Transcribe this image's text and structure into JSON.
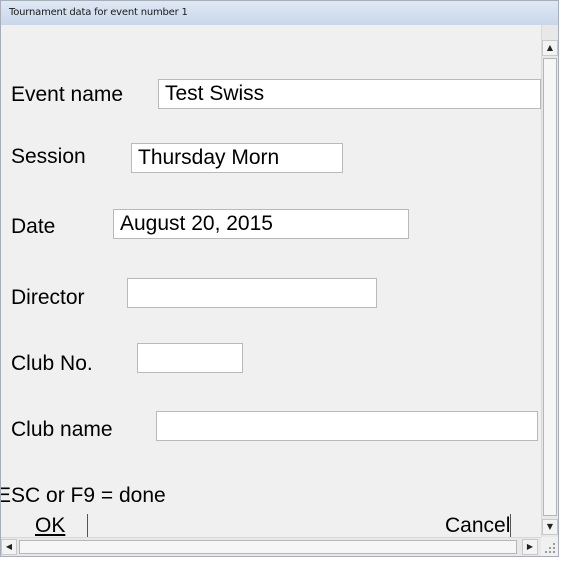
{
  "window": {
    "title": "Tournament data for event number 1"
  },
  "form": {
    "event_name": {
      "label": "Event name",
      "value": "Test Swiss"
    },
    "session": {
      "label": "Session",
      "value": "Thursday Morn"
    },
    "date": {
      "label": "Date",
      "value": "August 20, 2015"
    },
    "director": {
      "label": "Director",
      "value": ""
    },
    "club_no": {
      "label": "Club No.",
      "value": ""
    },
    "club_name": {
      "label": "Club name",
      "value": ""
    },
    "hint": "ESC or F9 = done"
  },
  "buttons": {
    "ok_label": "OK",
    "cancel_label": "Cancel"
  },
  "scrollbars": {
    "up_arrow": "▲",
    "down_arrow": "▼",
    "left_arrow": "◀",
    "right_arrow": "▶"
  }
}
